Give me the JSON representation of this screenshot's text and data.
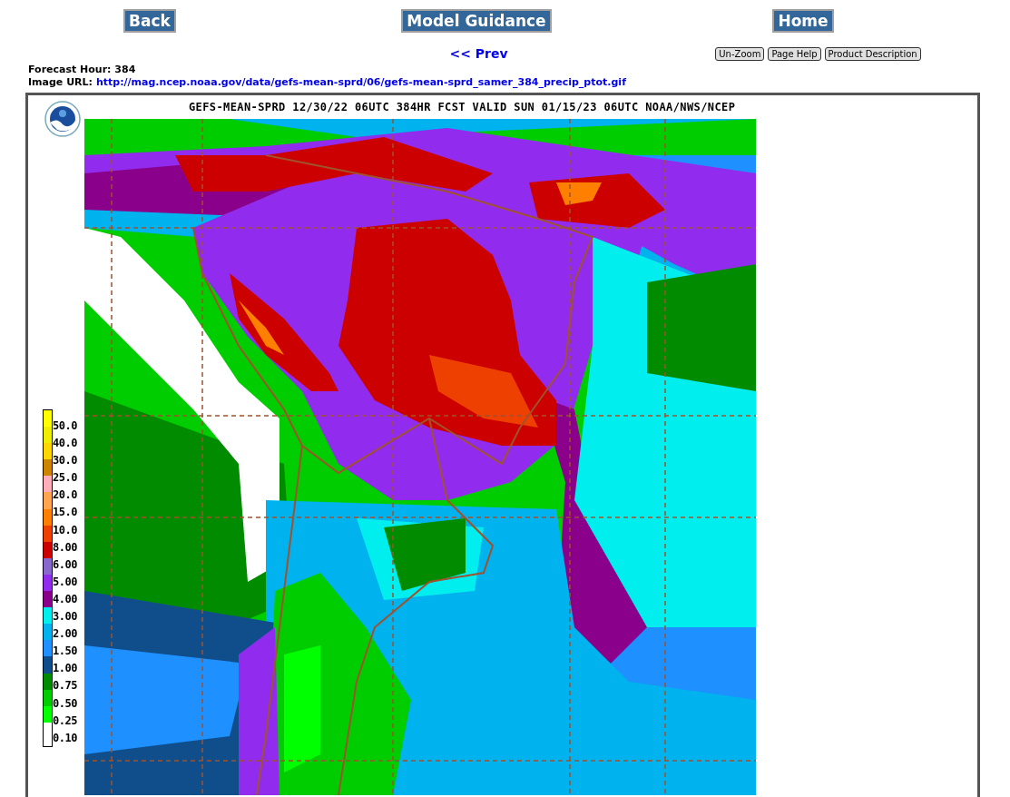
{
  "nav_buttons": [
    "Back",
    "Model Guidance",
    "Home"
  ],
  "prev_link": "<< Prev",
  "tool_buttons": [
    "Un-Zoom",
    "Page Help",
    "Product Description"
  ],
  "forecast_hour": {
    "label": "Forecast Hour:",
    "value": "384"
  },
  "image_url": {
    "label": "Image URL:",
    "link": "http://mag.ncep.noaa.gov/data/gefs-mean-sprd/06/gefs-mean-sprd_samer_384_precip_ptot.gif"
  },
  "map": {
    "title": "GEFS-MEAN-SPRD 12/30/22 06UTC 384HR FCST VALID SUN 01/15/23 06UTC NOAA/NWS/NCEP",
    "legend_swatches": [
      {
        "color": "#ffff00"
      },
      {
        "color": "#eeee00"
      },
      {
        "color": "#ffd700"
      },
      {
        "color": "#cd8500"
      },
      {
        "color": "#ffaeb9"
      },
      {
        "color": "#ffa54f"
      },
      {
        "color": "#ff7f00"
      },
      {
        "color": "#ee4000"
      },
      {
        "color": "#cd0000"
      },
      {
        "color": "#8968cd"
      },
      {
        "color": "#912cee"
      },
      {
        "color": "#8b008b"
      },
      {
        "color": "#00eeee"
      },
      {
        "color": "#00b2ee"
      },
      {
        "color": "#1e90ff"
      },
      {
        "color": "#104e8b"
      },
      {
        "color": "#008b00"
      },
      {
        "color": "#00cd00"
      },
      {
        "color": "#00ff00"
      },
      {
        "color": "#ffffff"
      }
    ],
    "legend_labels": [
      "50.0",
      "40.0",
      "30.0",
      "25.0",
      "20.0",
      "15.0",
      "10.0",
      "8.00",
      "6.00",
      "5.00",
      "4.00",
      "3.00",
      "2.00",
      "1.50",
      "1.00",
      "0.75",
      "0.50",
      "0.25",
      "0.10"
    ]
  }
}
